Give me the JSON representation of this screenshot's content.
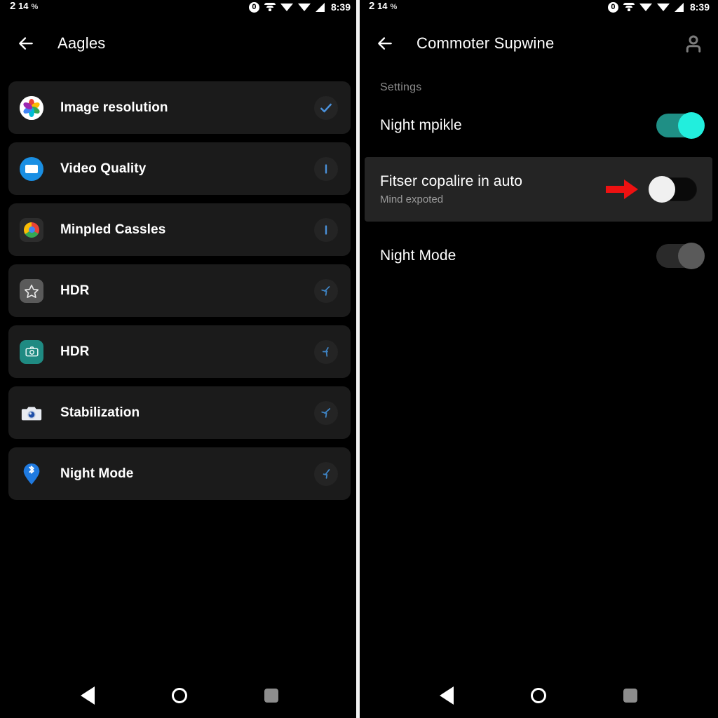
{
  "status_bar": {
    "battery_number": "2",
    "battery_value": "14",
    "percent_symbol": "%",
    "badge_count": "0",
    "time": "8:39",
    "icons": [
      "circle-zero-icon",
      "wifi-icon",
      "signal-triangle-icon",
      "signal-triangle-icon",
      "cellular-bars-icon"
    ]
  },
  "left_screen": {
    "appbar": {
      "title": "Aagles",
      "back_icon": "back-arrow-icon"
    },
    "items": [
      {
        "label": "Image resolution",
        "icon": "photos-icon",
        "trailing": "check-icon"
      },
      {
        "label": "Video Quality",
        "icon": "video-icon",
        "trailing": "bar-icon"
      },
      {
        "label": "Minpled Cassles",
        "icon": "chrome-icon",
        "trailing": "bar-icon"
      },
      {
        "label": "HDR",
        "icon": "star-icon",
        "trailing": "cursor-icon"
      },
      {
        "label": "HDR",
        "icon": "camera-teal-icon",
        "trailing": "cursor-icon"
      },
      {
        "label": "Stabilization",
        "icon": "camera-white-icon",
        "trailing": "cursor-icon"
      },
      {
        "label": "Night Mode",
        "icon": "bluetooth-pin-icon",
        "trailing": "cursor-icon"
      }
    ]
  },
  "right_screen": {
    "appbar": {
      "title": "Commoter Supwine",
      "back_icon": "back-arrow-icon",
      "account_icon": "account-icon"
    },
    "section_label": "Settings",
    "settings": [
      {
        "title": "Night mpikle",
        "subtitle": "",
        "toggle": "on",
        "highlighted": false,
        "arrow": false
      },
      {
        "title": "Fitser copalire in auto",
        "subtitle": "Mind expoted",
        "toggle": "off-white",
        "highlighted": true,
        "arrow": true
      },
      {
        "title": "Night Mode",
        "subtitle": "",
        "toggle": "off-gray",
        "highlighted": false,
        "arrow": false
      }
    ]
  },
  "nav_bar": {
    "back": "nav-back-icon",
    "home": "nav-home-icon",
    "recents": "nav-recents-icon"
  },
  "colors": {
    "background": "#000000",
    "card": "#1b1b1b",
    "highlight": "#242424",
    "toggle_on_track": "#1f8f85",
    "toggle_on_knob": "#22eedd",
    "arrow_red": "#ee1111",
    "accent_blue": "#4a90d9",
    "muted_text": "#8c8c8c"
  }
}
